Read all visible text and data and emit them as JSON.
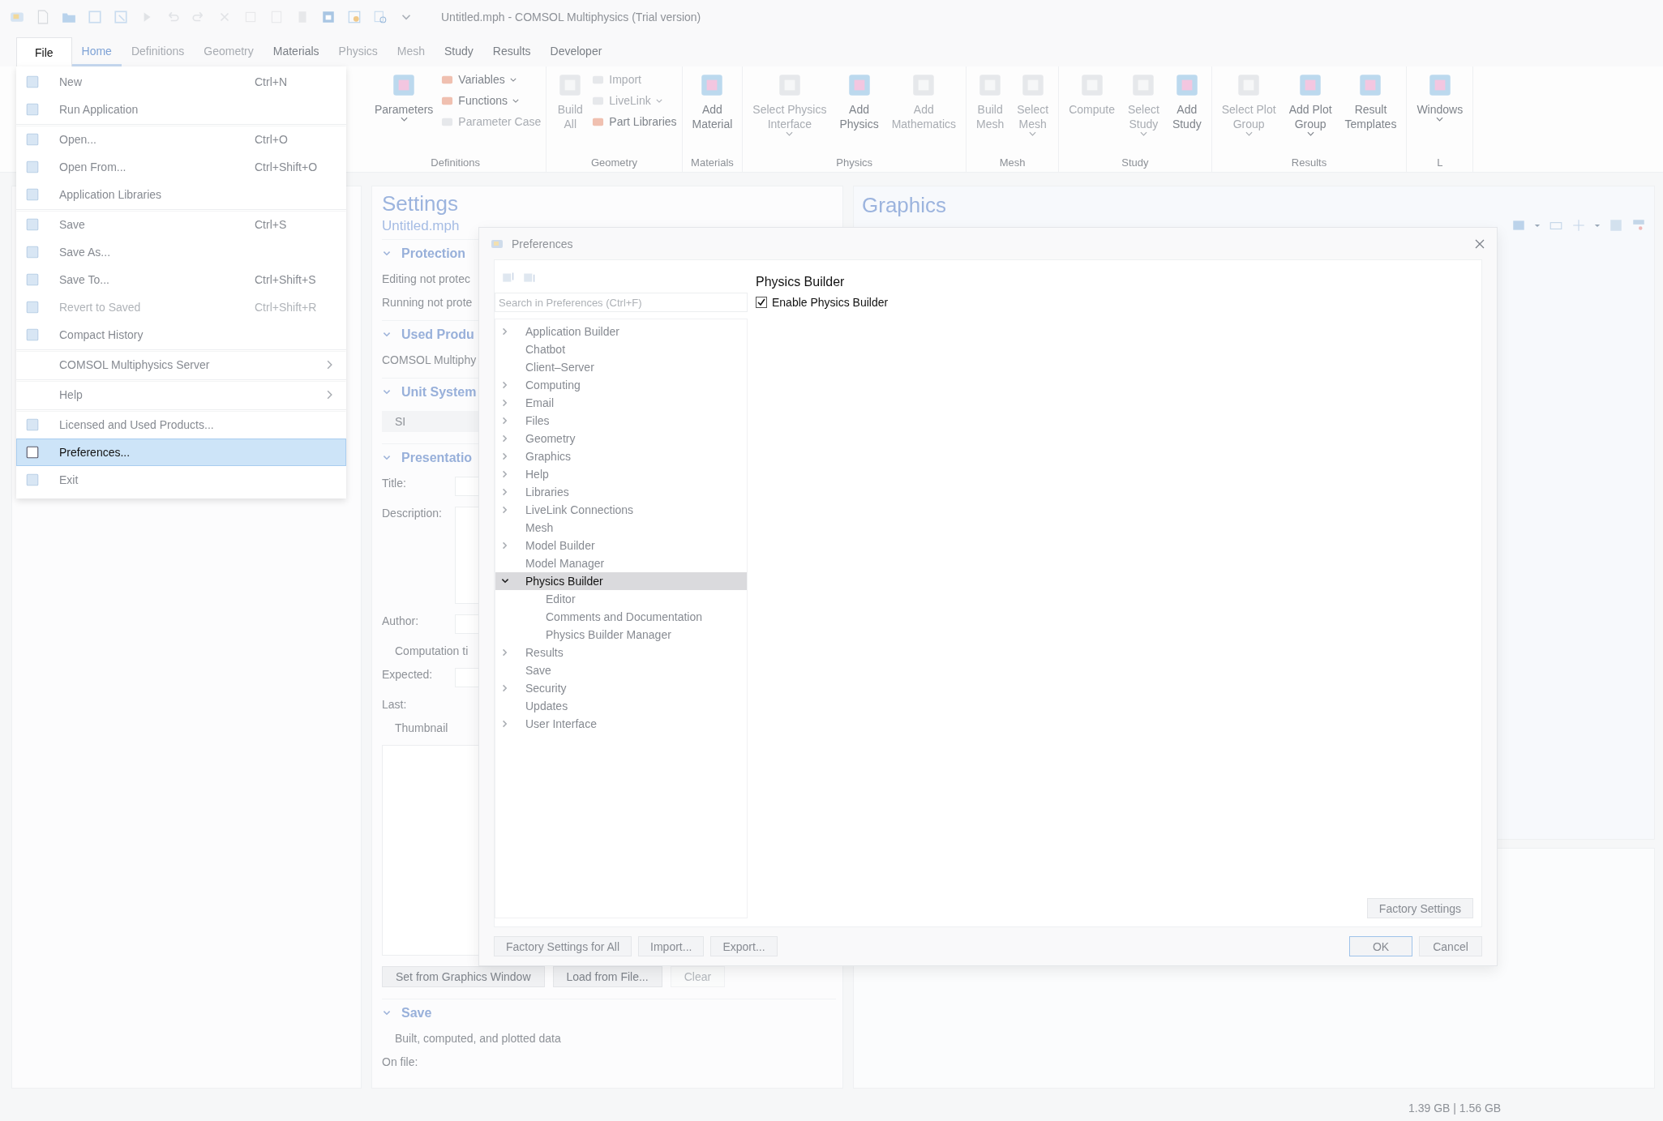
{
  "title_bar": {
    "title": "Untitled.mph - COMSOL Multiphysics (Trial version)"
  },
  "file_tab": {
    "label": "File",
    "open": true
  },
  "tabs": [
    {
      "label": "Home",
      "selected": true,
      "disabled": false
    },
    {
      "label": "Definitions",
      "selected": false,
      "disabled": true
    },
    {
      "label": "Geometry",
      "selected": false,
      "disabled": true
    },
    {
      "label": "Materials",
      "selected": false,
      "disabled": false
    },
    {
      "label": "Physics",
      "selected": false,
      "disabled": true
    },
    {
      "label": "Mesh",
      "selected": false,
      "disabled": true
    },
    {
      "label": "Study",
      "selected": false,
      "disabled": false
    },
    {
      "label": "Results",
      "selected": false,
      "disabled": false
    },
    {
      "label": "Developer",
      "selected": false,
      "disabled": false
    }
  ],
  "ribbon": [
    {
      "label": "Definitions",
      "buttons": [
        {
          "kind": "large",
          "lines": [
            "Parameters"
          ],
          "dropdown": true,
          "disabled": false
        },
        {
          "kind": "stack",
          "items": [
            {
              "label": "Variables",
              "dropdown": true,
              "disabled": false
            },
            {
              "label": "Functions",
              "dropdown": true,
              "disabled": false
            },
            {
              "label": "Parameter Case",
              "dropdown": false,
              "disabled": true
            }
          ]
        }
      ]
    },
    {
      "label": "Geometry",
      "buttons": [
        {
          "kind": "large",
          "lines": [
            "Build",
            "All"
          ],
          "dropdown": false,
          "disabled": true
        },
        {
          "kind": "stack",
          "items": [
            {
              "label": "Import",
              "dropdown": false,
              "disabled": true
            },
            {
              "label": "LiveLink",
              "dropdown": true,
              "disabled": true
            },
            {
              "label": "Part Libraries",
              "dropdown": false,
              "disabled": false
            }
          ]
        }
      ]
    },
    {
      "label": "Materials",
      "buttons": [
        {
          "kind": "large",
          "lines": [
            "Add",
            "Material"
          ],
          "dropdown": false,
          "disabled": false
        }
      ]
    },
    {
      "label": "Physics",
      "buttons": [
        {
          "kind": "large",
          "lines": [
            "Select Physics",
            "Interface"
          ],
          "dropdown": true,
          "disabled": true
        },
        {
          "kind": "large",
          "lines": [
            "Add",
            "Physics"
          ],
          "dropdown": false,
          "disabled": false
        },
        {
          "kind": "large",
          "lines": [
            "Add",
            "Mathematics"
          ],
          "dropdown": false,
          "disabled": true
        }
      ]
    },
    {
      "label": "Mesh",
      "buttons": [
        {
          "kind": "large",
          "lines": [
            "Build",
            "Mesh"
          ],
          "dropdown": false,
          "disabled": true
        },
        {
          "kind": "large",
          "lines": [
            "Select",
            "Mesh"
          ],
          "dropdown": true,
          "disabled": true
        }
      ]
    },
    {
      "label": "Study",
      "buttons": [
        {
          "kind": "large",
          "lines": [
            "Compute"
          ],
          "dropdown": false,
          "disabled": true
        },
        {
          "kind": "large",
          "lines": [
            "Select",
            "Study"
          ],
          "dropdown": true,
          "disabled": true
        },
        {
          "kind": "large",
          "lines": [
            "Add",
            "Study"
          ],
          "dropdown": false,
          "disabled": false
        }
      ]
    },
    {
      "label": "Results",
      "buttons": [
        {
          "kind": "large",
          "lines": [
            "Select Plot",
            "Group"
          ],
          "dropdown": true,
          "disabled": true
        },
        {
          "kind": "large",
          "lines": [
            "Add Plot",
            "Group"
          ],
          "dropdown": true,
          "disabled": false
        },
        {
          "kind": "large",
          "lines": [
            "Result",
            "Templates"
          ],
          "dropdown": false,
          "disabled": false
        }
      ]
    },
    {
      "label": "L",
      "buttons": [
        {
          "kind": "large",
          "lines": [
            "Windows"
          ],
          "dropdown": true,
          "disabled": false
        }
      ]
    }
  ],
  "file_menu": [
    {
      "label": "New",
      "shortcut": "Ctrl+N",
      "has_icon": true,
      "submenu": false,
      "disabled": false,
      "selected": false,
      "separator_before": false
    },
    {
      "label": "Run Application",
      "has_icon": true,
      "submenu": false,
      "disabled": false,
      "selected": false,
      "separator_before": false
    },
    {
      "label": "Open...",
      "shortcut": "Ctrl+O",
      "has_icon": true,
      "submenu": false,
      "disabled": false,
      "selected": false,
      "separator_before": true
    },
    {
      "label": "Open From...",
      "shortcut": "Ctrl+Shift+O",
      "has_icon": true,
      "submenu": false,
      "disabled": false,
      "selected": false,
      "separator_before": false
    },
    {
      "label": "Application Libraries",
      "has_icon": true,
      "submenu": false,
      "disabled": false,
      "selected": false,
      "separator_before": false
    },
    {
      "label": "Save",
      "shortcut": "Ctrl+S",
      "has_icon": true,
      "submenu": false,
      "disabled": false,
      "selected": false,
      "separator_before": true
    },
    {
      "label": "Save As...",
      "has_icon": true,
      "submenu": false,
      "disabled": false,
      "selected": false,
      "separator_before": false
    },
    {
      "label": "Save To...",
      "shortcut": "Ctrl+Shift+S",
      "has_icon": true,
      "submenu": false,
      "disabled": false,
      "selected": false,
      "separator_before": false
    },
    {
      "label": "Revert to Saved",
      "shortcut": "Ctrl+Shift+R",
      "has_icon": true,
      "submenu": false,
      "disabled": true,
      "selected": false,
      "separator_before": false
    },
    {
      "label": "Compact History",
      "has_icon": true,
      "submenu": false,
      "disabled": false,
      "selected": false,
      "separator_before": false
    },
    {
      "label": "COMSOL Multiphysics Server",
      "has_icon": false,
      "submenu": true,
      "disabled": false,
      "selected": false,
      "separator_before": true
    },
    {
      "label": "Help",
      "has_icon": false,
      "submenu": true,
      "disabled": false,
      "selected": false,
      "separator_before": true
    },
    {
      "label": "Licensed and Used Products...",
      "has_icon": true,
      "submenu": false,
      "disabled": false,
      "selected": false,
      "separator_before": true
    },
    {
      "label": "Preferences...",
      "has_icon": true,
      "submenu": false,
      "disabled": false,
      "selected": true,
      "separator_before": false
    },
    {
      "label": "Exit",
      "has_icon": true,
      "submenu": false,
      "disabled": false,
      "selected": false,
      "separator_before": false
    }
  ],
  "settings": {
    "title": "Settings",
    "subtitle": "Untitled.mph",
    "sections": [
      {
        "title": "Protection",
        "expanded": true,
        "rows": [
          {
            "kind": "text",
            "text": "Editing not protec"
          },
          {
            "kind": "text",
            "text": "Running not prote"
          }
        ]
      },
      {
        "title": "Used Produ",
        "expanded": true,
        "rows": [
          {
            "kind": "text",
            "text": "COMSOL Multiphy"
          }
        ]
      },
      {
        "title": "Unit System",
        "expanded": true,
        "rows": [
          {
            "kind": "select",
            "value": "SI"
          }
        ]
      },
      {
        "title": "Presentatio",
        "expanded": true,
        "rows": [
          {
            "kind": "field",
            "label": "Title:"
          },
          {
            "kind": "area",
            "label": "Description:"
          },
          {
            "kind": "field",
            "label": "Author:"
          },
          {
            "kind": "heading",
            "text": "Computation ti"
          },
          {
            "kind": "field",
            "label": "Expected:"
          },
          {
            "kind": "text",
            "text": "Last:"
          },
          {
            "kind": "heading",
            "text": "Thumbnail"
          },
          {
            "kind": "thumbnail"
          },
          {
            "kind": "buttons",
            "buttons": [
              {
                "label": "Set from Graphics Window",
                "disabled": false
              },
              {
                "label": "Load from File...",
                "disabled": false
              },
              {
                "label": "Clear",
                "disabled": true
              }
            ]
          }
        ]
      },
      {
        "title": "Save",
        "expanded": true,
        "rows": [
          {
            "kind": "heading",
            "text": "Built, computed, and plotted data"
          },
          {
            "kind": "text",
            "text": "On file:"
          }
        ]
      }
    ]
  },
  "graphics": {
    "title": "Graphics"
  },
  "status_bar": {
    "memory": "1.39 GB | 1.56 GB"
  },
  "dialog": {
    "title": "Preferences",
    "search": {
      "placeholder": "Search in Preferences (Ctrl+F)"
    },
    "tree": [
      {
        "label": "Application Builder",
        "expandable": true,
        "expanded": false,
        "selected": false
      },
      {
        "label": "Chatbot",
        "expandable": false,
        "selected": false
      },
      {
        "label": "Client–Server",
        "expandable": false,
        "selected": false
      },
      {
        "label": "Computing",
        "expandable": true,
        "expanded": false,
        "selected": false
      },
      {
        "label": "Email",
        "expandable": true,
        "expanded": false,
        "selected": false
      },
      {
        "label": "Files",
        "expandable": true,
        "expanded": false,
        "selected": false
      },
      {
        "label": "Geometry",
        "expandable": true,
        "expanded": false,
        "selected": false
      },
      {
        "label": "Graphics",
        "expandable": true,
        "expanded": false,
        "selected": false
      },
      {
        "label": "Help",
        "expandable": true,
        "expanded": false,
        "selected": false
      },
      {
        "label": "Libraries",
        "expandable": true,
        "expanded": false,
        "selected": false
      },
      {
        "label": "LiveLink Connections",
        "expandable": true,
        "expanded": false,
        "selected": false
      },
      {
        "label": "Mesh",
        "expandable": false,
        "selected": false
      },
      {
        "label": "Model Builder",
        "expandable": true,
        "expanded": false,
        "selected": false
      },
      {
        "label": "Model Manager",
        "expandable": false,
        "selected": false
      },
      {
        "label": "Physics Builder",
        "expandable": true,
        "expanded": true,
        "selected": true,
        "children": [
          {
            "label": "Editor",
            "selected": false
          },
          {
            "label": "Comments and Documentation",
            "selected": false
          },
          {
            "label": "Physics Builder Manager",
            "selected": false
          }
        ]
      },
      {
        "label": "Results",
        "expandable": true,
        "expanded": false,
        "selected": false
      },
      {
        "label": "Save",
        "expandable": false,
        "selected": false
      },
      {
        "label": "Security",
        "expandable": true,
        "expanded": false,
        "selected": false
      },
      {
        "label": "Updates",
        "expandable": false,
        "selected": false
      },
      {
        "label": "User Interface",
        "expandable": true,
        "expanded": false,
        "selected": false
      }
    ],
    "page_title": "Physics Builder",
    "checkbox": {
      "label": "Enable Physics Builder",
      "checked": true
    },
    "factory_button": "Factory Settings",
    "left_buttons": [
      "Factory Settings for All",
      "Import...",
      "Export..."
    ],
    "right_buttons": [
      {
        "label": "OK",
        "default": true
      },
      {
        "label": "Cancel",
        "default": false
      }
    ]
  }
}
